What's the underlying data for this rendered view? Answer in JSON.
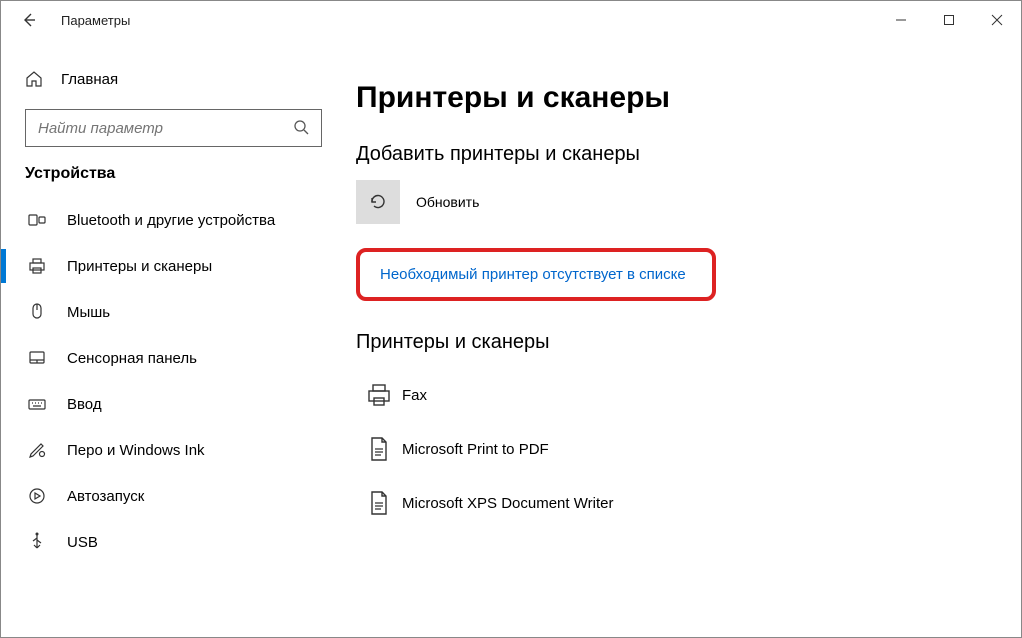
{
  "window": {
    "title": "Параметры"
  },
  "sidebar": {
    "home": "Главная",
    "search_placeholder": "Найти параметр",
    "section": "Устройства",
    "items": [
      {
        "label": "Bluetooth и другие устройства"
      },
      {
        "label": "Принтеры и сканеры"
      },
      {
        "label": "Мышь"
      },
      {
        "label": "Сенсорная панель"
      },
      {
        "label": "Ввод"
      },
      {
        "label": "Перо и Windows Ink"
      },
      {
        "label": "Автозапуск"
      },
      {
        "label": "USB"
      }
    ]
  },
  "content": {
    "title": "Принтеры и сканеры",
    "add_heading": "Добавить принтеры и сканеры",
    "refresh_label": "Обновить",
    "missing_link": "Необходимый принтер отсутствует в списке",
    "list_heading": "Принтеры и сканеры",
    "printers": [
      {
        "label": "Fax"
      },
      {
        "label": "Microsoft Print to PDF"
      },
      {
        "label": "Microsoft XPS Document Writer"
      }
    ]
  }
}
